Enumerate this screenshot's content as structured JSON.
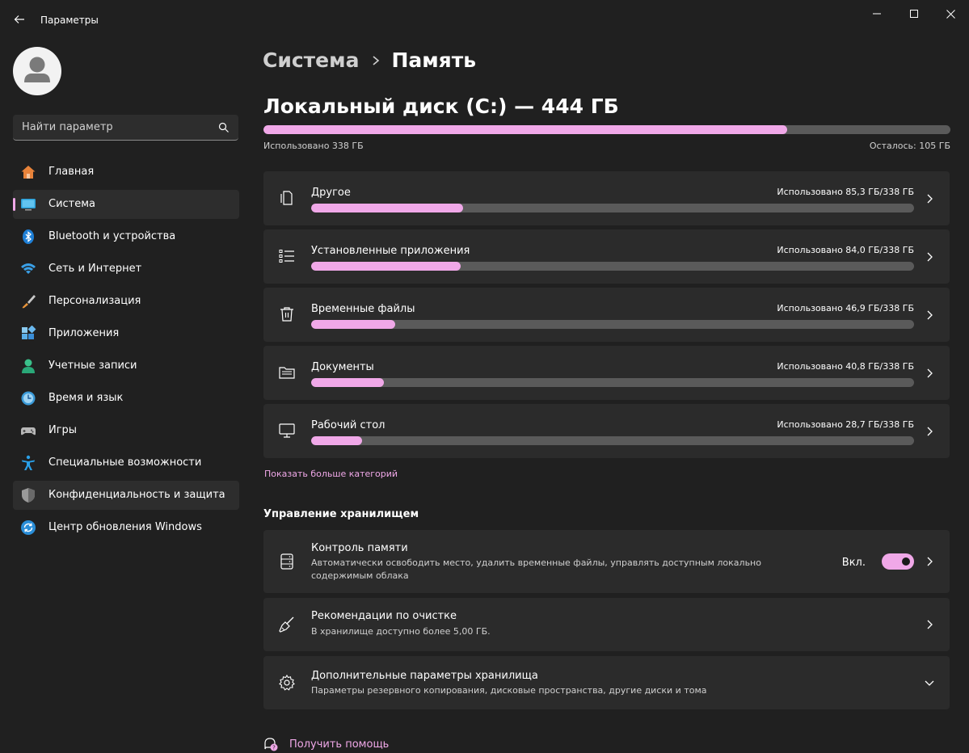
{
  "window": {
    "title": "Параметры"
  },
  "sidebar": {
    "search_placeholder": "Найти параметр",
    "items": [
      {
        "label": "Главная",
        "icon": "home-icon"
      },
      {
        "label": "Система",
        "icon": "system-icon",
        "active": true
      },
      {
        "label": "Bluetooth и устройства",
        "icon": "bluetooth-icon"
      },
      {
        "label": "Сеть и Интернет",
        "icon": "wifi-icon"
      },
      {
        "label": "Персонализация",
        "icon": "brush-icon"
      },
      {
        "label": "Приложения",
        "icon": "apps-icon"
      },
      {
        "label": "Учетные записи",
        "icon": "accounts-icon"
      },
      {
        "label": "Время и язык",
        "icon": "time-language-icon"
      },
      {
        "label": "Игры",
        "icon": "gamepad-icon"
      },
      {
        "label": "Специальные возможности",
        "icon": "accessibility-icon"
      },
      {
        "label": "Конфиденциальность и защита",
        "icon": "shield-icon"
      },
      {
        "label": "Центр обновления Windows",
        "icon": "update-icon"
      }
    ]
  },
  "breadcrumb": {
    "parent": "Система",
    "current": "Память"
  },
  "disk": {
    "title": "Локальный диск (C:) — 444 ГБ",
    "used_label": "Использовано 338 ГБ",
    "free_label": "Осталось: 105 ГБ",
    "used_fraction": 0.762
  },
  "categories": [
    {
      "name": "Другое",
      "used": "Использовано 85,3 ГБ/338 ГБ",
      "fraction": 0.252,
      "icon": "other-file-icon"
    },
    {
      "name": "Установленные приложения",
      "used": "Использовано 84,0 ГБ/338 ГБ",
      "fraction": 0.248,
      "icon": "app-list-icon"
    },
    {
      "name": "Временные файлы",
      "used": "Использовано 46,9 ГБ/338 ГБ",
      "fraction": 0.139,
      "icon": "trash-icon"
    },
    {
      "name": "Документы",
      "used": "Использовано 40,8 ГБ/338 ГБ",
      "fraction": 0.121,
      "icon": "folder-icon"
    },
    {
      "name": "Рабочий стол",
      "used": "Использовано 28,7 ГБ/338 ГБ",
      "fraction": 0.085,
      "icon": "monitor-icon"
    }
  ],
  "show_more": "Показать больше категорий",
  "management": {
    "title": "Управление хранилищем",
    "storage_sense": {
      "title": "Контроль памяти",
      "description": "Автоматически освободить место, удалить временные файлы, управлять доступным локально содержимым облака",
      "toggle_label": "Вкл.",
      "enabled": true
    },
    "cleanup": {
      "title": "Рекомендации по очистке",
      "description": "В хранилище доступно более 5,00 ГБ."
    },
    "advanced": {
      "title": "Дополнительные параметры хранилища",
      "description": "Параметры резервного копирования, дисковые пространства, другие диски и тома"
    }
  },
  "help": {
    "label": "Получить помощь"
  },
  "colors": {
    "accent": "#f0a8e8",
    "background": "#202020",
    "card": "#2b2b2b",
    "track": "#5a5a5a"
  }
}
